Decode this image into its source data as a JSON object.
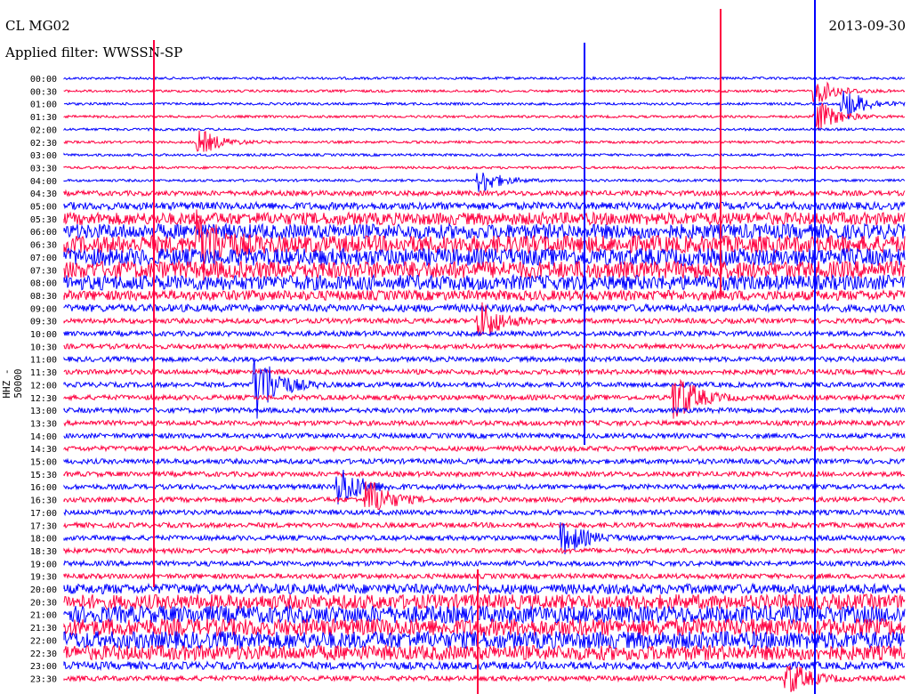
{
  "header": {
    "station": "CL MG02",
    "filter": "Applied filter: WWSSN-SP",
    "date": "2013-09-30",
    "channel_label": "HHZ - 50000"
  },
  "colors": {
    "trace_a": "#0000ff",
    "trace_b": "#ff0040",
    "text": "#000000"
  },
  "chart_data": {
    "type": "line",
    "title": "CL MG02",
    "subtitle": "Applied filter: WWSSN-SP",
    "ylabel": "HHZ - 50000",
    "row_labels": [
      "00:00",
      "00:30",
      "01:00",
      "01:30",
      "02:00",
      "02:30",
      "03:00",
      "03:30",
      "04:00",
      "04:30",
      "05:00",
      "05:30",
      "06:00",
      "06:30",
      "07:00",
      "07:30",
      "08:00",
      "08:30",
      "09:00",
      "09:30",
      "10:00",
      "10:30",
      "11:00",
      "11:30",
      "12:00",
      "12:30",
      "13:00",
      "13:30",
      "14:00",
      "14:30",
      "15:00",
      "15:30",
      "16:00",
      "16:30",
      "17:00",
      "17:30",
      "18:00",
      "18:30",
      "19:00",
      "19:30",
      "20:00",
      "20:30",
      "21:00",
      "21:30",
      "22:00",
      "22:30",
      "23:00",
      "23:30"
    ],
    "row_colors": [
      "blue",
      "red"
    ],
    "noise_level": [
      1,
      1,
      1,
      1,
      1,
      1,
      1,
      1,
      1,
      2,
      3,
      5,
      6,
      7,
      7,
      7,
      6,
      4,
      3,
      2,
      2,
      2,
      2,
      2,
      2,
      2,
      2,
      2,
      2,
      2,
      2,
      2,
      2,
      2,
      2,
      2,
      2,
      2,
      2,
      2,
      4,
      6,
      7,
      7,
      7,
      6,
      3,
      2
    ],
    "events": [
      {
        "row": 1,
        "t_min": 27,
        "amp": 3
      },
      {
        "row": 3,
        "t_min": 27,
        "amp": 4
      },
      {
        "row": 2,
        "t_min": 28,
        "amp": 4
      },
      {
        "row": 5,
        "t_min": 5,
        "amp": 3
      },
      {
        "row": 8,
        "t_min": 15,
        "amp": 3
      },
      {
        "row": 13,
        "t_min": 5,
        "amp": 8
      },
      {
        "row": 19,
        "t_min": 15,
        "amp": 5
      },
      {
        "row": 24,
        "t_min": 7,
        "amp": 9
      },
      {
        "row": 25,
        "t_min": 22,
        "amp": 6
      },
      {
        "row": 33,
        "t_min": 11,
        "amp": 5
      },
      {
        "row": 32,
        "t_min": 10,
        "amp": 5
      },
      {
        "row": 36,
        "t_min": 18,
        "amp": 4
      },
      {
        "row": 47,
        "t_min": 26,
        "amp": 4
      }
    ]
  }
}
